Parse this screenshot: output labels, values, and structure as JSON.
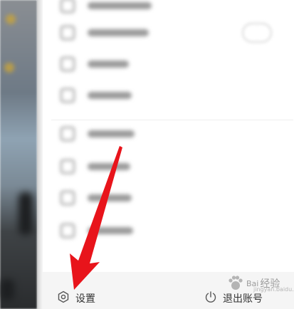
{
  "bottom_bar": {
    "settings_label": "设置",
    "settings_icon": "gear-icon",
    "logout_label": "退出账号",
    "logout_icon": "power-icon"
  },
  "watermark": {
    "brand": "Bai",
    "text": "经验",
    "subtext": "jingyan.baidu.com"
  },
  "menu": {
    "items": [
      "",
      "",
      "",
      "",
      "",
      "",
      "",
      ""
    ]
  },
  "colors": {
    "arrow": "#e8141b",
    "bottom_bar_bg": "#f5f5f5",
    "drawer_bg": "#ffffff"
  }
}
